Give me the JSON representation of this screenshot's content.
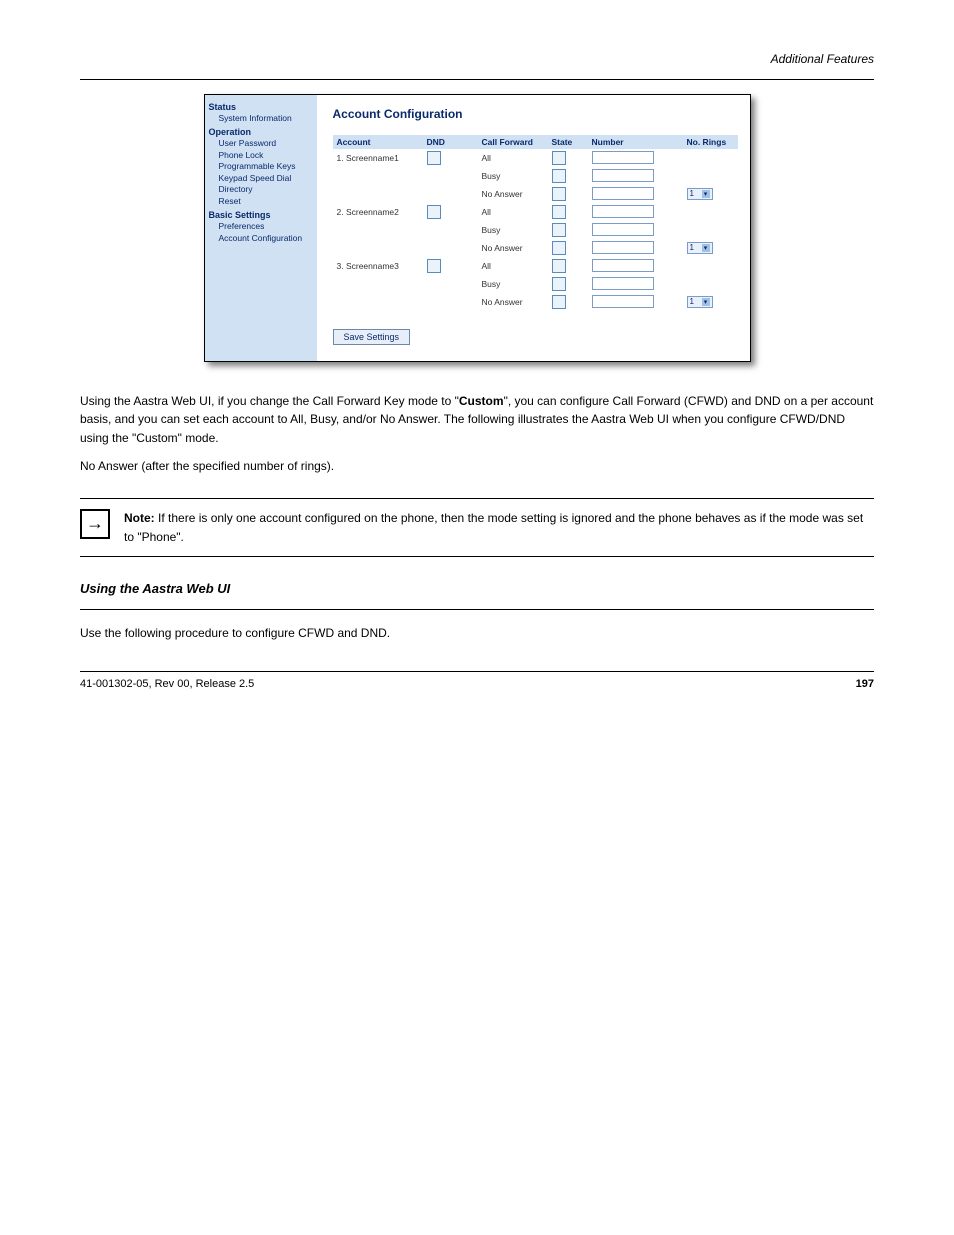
{
  "doc": {
    "section_header": "Additional Features",
    "note_label": "Note:",
    "note_body": "If there is only one account configured on the phone, then the mode setting is ignored and the phone behaves as if the mode was set to \"Phone\".",
    "para_custom_intro": "Using the Aastra Web UI, if you change the Call Forward Key mode to \"",
    "para_custom_mode": "Custom",
    "para_custom_tail": "\", you can configure Call Forward (CFWD) and DND on a per account basis, and you can set each account to All, Busy, and/or No Answer. The following illustrates the Aastra Web UI when you configure CFWD/DND using the \"Custom\" mode.",
    "answer_line": "No Answer (after the specified number of rings).",
    "footer_left": "41-001302-05, Rev 00, Release 2.5",
    "footer_right": "197"
  },
  "ui": {
    "title": "Account Configuration",
    "sidebar": {
      "status": "Status",
      "status_items": [
        "System Information"
      ],
      "operation": "Operation",
      "operation_items": [
        "User Password",
        "Phone Lock",
        "Programmable Keys",
        "Keypad Speed Dial",
        "Directory",
        "Reset"
      ],
      "basic": "Basic Settings",
      "basic_items": [
        "Preferences",
        "Account Configuration"
      ]
    },
    "headers": {
      "account": "Account",
      "dnd": "DND",
      "cfwd": "Call Forward",
      "state": "State",
      "number": "Number",
      "rings": "No. Rings"
    },
    "cfwd_labels": {
      "all": "All",
      "busy": "Busy",
      "na": "No Answer"
    },
    "accounts": [
      {
        "label": "1. Screenname1",
        "rings": "1"
      },
      {
        "label": "2. Screenname2",
        "rings": "1"
      },
      {
        "label": "3. Screenname3",
        "rings": "1"
      }
    ],
    "save_label": "Save Settings"
  }
}
